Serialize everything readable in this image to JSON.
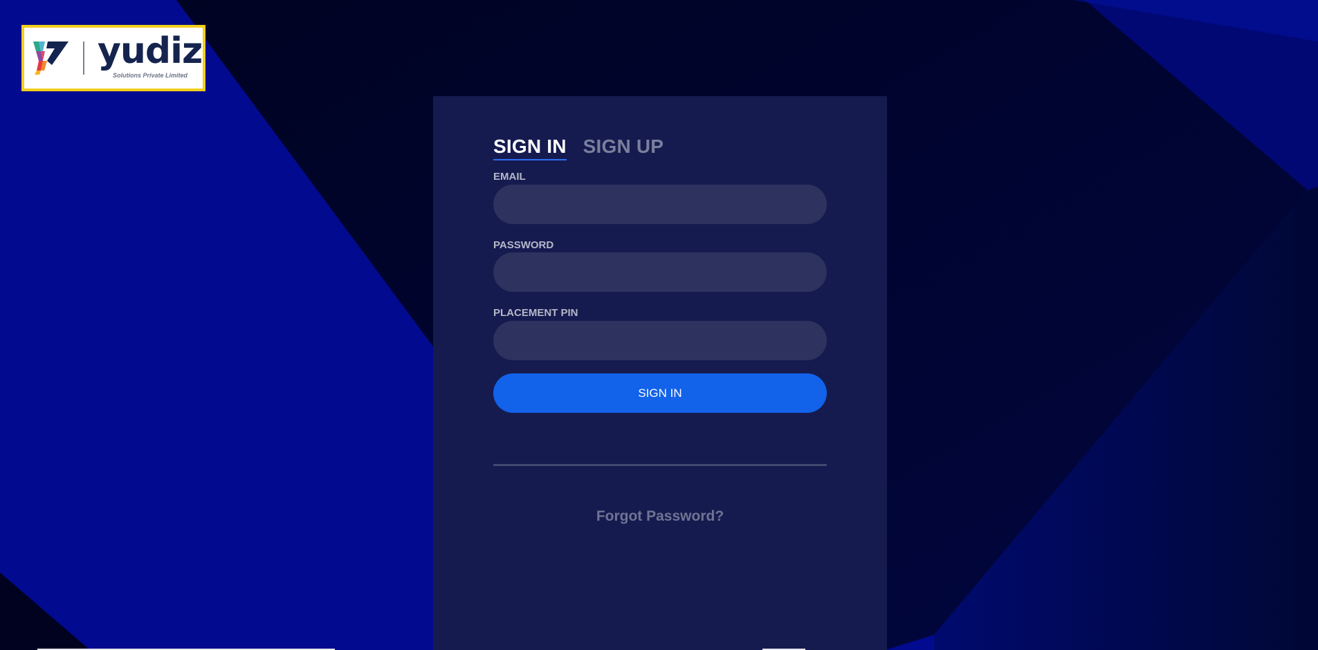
{
  "brand": {
    "name": "yudiz",
    "tagline": "Solutions Private Limited"
  },
  "auth": {
    "tabs": [
      {
        "label": "SIGN IN",
        "active": true
      },
      {
        "label": "SIGN UP",
        "active": false
      }
    ],
    "fields": {
      "email": {
        "label": "EMAIL",
        "value": "",
        "placeholder": ""
      },
      "password": {
        "label": "PASSWORD",
        "value": "",
        "placeholder": ""
      },
      "pin": {
        "label": "PLACEMENT PIN",
        "value": "",
        "placeholder": ""
      }
    },
    "submit_label": "SIGN IN",
    "forgot_label": "Forgot Password?"
  },
  "colors": {
    "background": "#020a8f",
    "card": "#151b4f",
    "input": "#2e325f",
    "accent": "#1262ea",
    "logo_border": "#f2cf1d"
  },
  "icons": {
    "brand_mark": "yudiz-v-logo-icon"
  }
}
